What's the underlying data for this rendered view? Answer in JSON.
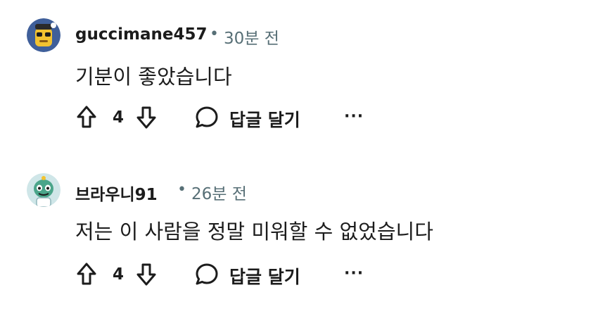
{
  "comments": [
    {
      "username": "guccimane457",
      "separator": "•",
      "time": "30분 전",
      "text": "기분이 좋았습니다",
      "vote_count": "4",
      "reply_label": "답글 달기",
      "more_label": "···",
      "avatar_icon": "yellow-robot-avatar-icon"
    },
    {
      "username": "브라우니91",
      "separator": "•",
      "time": "26분 전",
      "text": "저는 이 사람을 정말 미워할 수 없었습니다",
      "vote_count": "4",
      "reply_label": "답글 달기",
      "more_label": "···",
      "avatar_icon": "green-alien-avatar-icon"
    }
  ],
  "colors": {
    "text": "#1c1c1c",
    "meta": "#576f76",
    "avatar_bg_1": "#3f5f9a",
    "avatar_bg_2": "#cfe6e8"
  }
}
